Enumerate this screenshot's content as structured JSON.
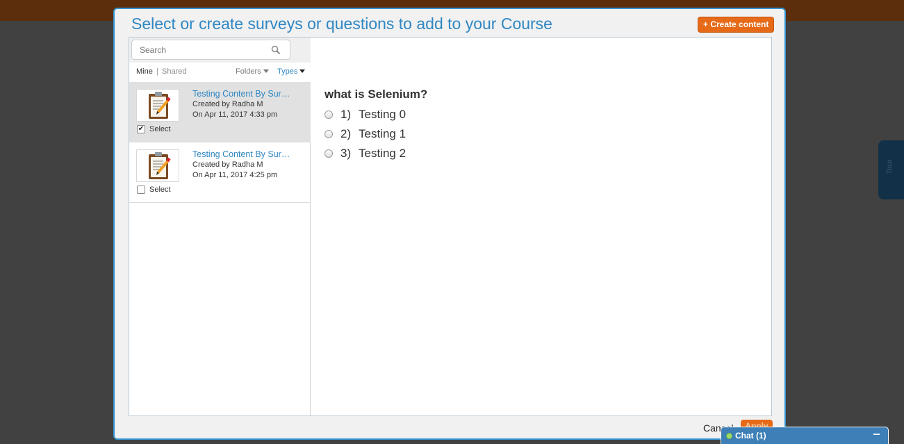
{
  "dialog": {
    "title": "Select or create surveys or questions to add to your Course",
    "create_label": "+ Create content"
  },
  "search": {
    "placeholder": "Search"
  },
  "filters": {
    "mine": "Mine",
    "separator": "|",
    "shared": "Shared",
    "folders": "Folders",
    "types": "Types"
  },
  "items": [
    {
      "title": "Testing Content By Sur…",
      "created_by": "Created by Radha M",
      "date": "On Apr 11, 2017 4:33 pm",
      "select_label": "Select",
      "checked": true
    },
    {
      "title": "Testing Content By Sur…",
      "created_by": "Created by Radha M",
      "date": "On Apr 11, 2017 4:25 pm",
      "select_label": "Select",
      "checked": false
    }
  ],
  "preview": {
    "question": "what is Selenium?",
    "options": [
      {
        "num": "1)",
        "text": "Testing 0"
      },
      {
        "num": "2)",
        "text": "Testing 1"
      },
      {
        "num": "3)",
        "text": "Testing 2"
      }
    ]
  },
  "footer": {
    "cancel": "Cancel",
    "apply": "Apply"
  },
  "chat": {
    "label": "Chat  (1)"
  },
  "tour": {
    "label": "Tour"
  },
  "colors": {
    "accent": "#2f87c3",
    "button_orange": "#e66a18",
    "chat_blue": "#3d7fb6"
  }
}
